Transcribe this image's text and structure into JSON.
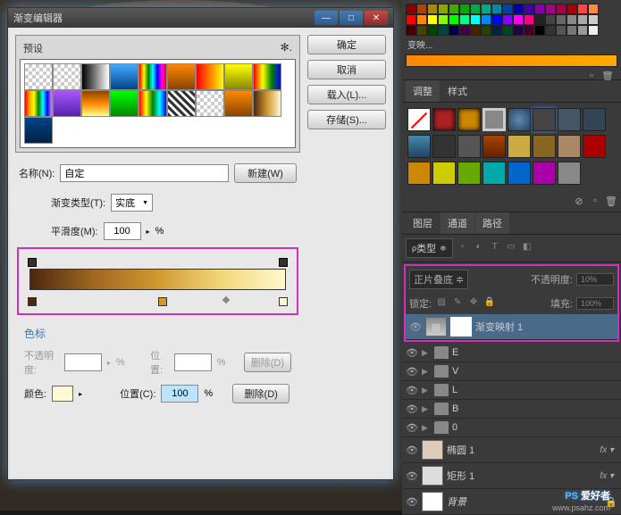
{
  "dialog": {
    "title": "渐变编辑器",
    "presets_label": "预设",
    "buttons": {
      "ok": "确定",
      "cancel": "取消",
      "load": "载入(L)...",
      "save": "存储(S)..."
    },
    "name_label": "名称(N):",
    "name_value": "自定",
    "new_btn": "新建(W)",
    "gradient_type_label": "渐变类型(T):",
    "gradient_type_value": "实底",
    "smoothness_label": "平滑度(M):",
    "smoothness_value": "100",
    "smoothness_unit": "%",
    "stops_label": "色标",
    "stop_opacity_label": "不透明度:",
    "stop_opacity_unit": "%",
    "stop_pos_label": "位置:",
    "stop_pos_unit": "%",
    "delete_btn": "删除(D)",
    "color_label": "颜色:",
    "color_pos_label": "位置(C):",
    "color_pos_value": "100",
    "color_pos_unit": "%"
  },
  "panels": {
    "tabs": {
      "adjustments": "调整",
      "styles": "样式"
    },
    "layers_tabs": {
      "layers": "图层",
      "channels": "通道",
      "paths": "路径"
    },
    "layer_type": "类型",
    "blend_mode": "正片叠底",
    "opacity_label": "不透明度:",
    "opacity_value": "10%",
    "lock_label": "锁定:",
    "fill_label": "填充:",
    "fill_value": "100%",
    "layers": {
      "grad_map": "渐变映射 1",
      "e": "E",
      "v": "V",
      "l": "L",
      "b": "B",
      "zero": "0",
      "ellipse": "椭圆 1",
      "rect": "矩形 1",
      "background": "背景"
    }
  },
  "watermark": {
    "text1": "PS",
    "text2": " 爱好者",
    "sub": "www.psahz.com"
  },
  "swatch_label": "变映...",
  "chart_data": {
    "type": "gradient",
    "stops": [
      {
        "position": 0,
        "color": "#4a2810"
      },
      {
        "position": 50,
        "color": "#d09830"
      },
      {
        "position": 100,
        "color": "#fff8d0"
      }
    ],
    "opacity_stops": [
      {
        "position": 0,
        "opacity": 100
      },
      {
        "position": 100,
        "opacity": 100
      }
    ],
    "midpoint": 75
  }
}
